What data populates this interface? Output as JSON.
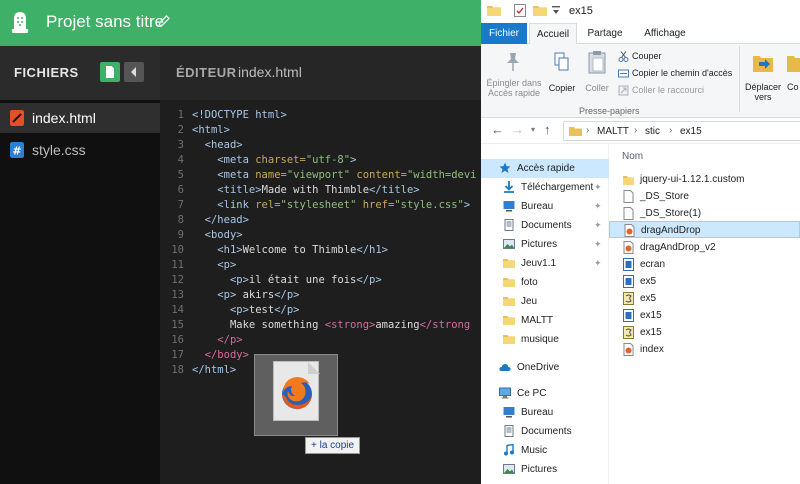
{
  "thimble": {
    "project_title": "Projet sans titre",
    "files_header": "FICHIERS",
    "editor_label": "ÉDITEUR",
    "editor_filename": "index.html",
    "files": [
      {
        "name": "index.html",
        "icon": "html-file-icon"
      },
      {
        "name": "style.css",
        "icon": "css-file-icon"
      }
    ],
    "line_numbers": [
      "1",
      "2",
      "3",
      "4",
      "5",
      "6",
      "7",
      "8",
      "9",
      "10",
      "11",
      "12",
      "13",
      "14",
      "15",
      "16",
      "17",
      "18"
    ],
    "code": {
      "l1": "<!DOCTYPE html>",
      "l2": "<html>",
      "l3": "<head>",
      "l4_tag": "<meta",
      "l4_attr": "charset=",
      "l4_val": "\"utf-8\"",
      "l4_end": ">",
      "l5_tag": "<meta",
      "l5_attr": "name=",
      "l5_val": "\"viewport\"",
      "l5_attr2": "content=",
      "l5_val2": "\"width=devi",
      "l6_tag": "<title>",
      "l6_text": "Made with Thimble",
      "l6_end": "</title>",
      "l7_tag": "<link",
      "l7_attr": "rel=",
      "l7_val": "\"stylesheet\"",
      "l7_attr2": "href=",
      "l7_val2": "\"style.css\"",
      "l7_end": ">",
      "l8": "</head>",
      "l9": "<body>",
      "l10_tag": "<h1>",
      "l10_text": "Welcome to Thimble",
      "l10_end": "</h1>",
      "l11": "<p>",
      "l12_tag": "<p>",
      "l12_text": "il était une fois",
      "l12_end": "</p>",
      "l13_tag": "<p>",
      "l13_text": " akirs",
      "l13_end": "</p>",
      "l14_tag": "<p>",
      "l14_text": "test",
      "l14_end": "</p>",
      "l15_text": "Make something ",
      "l15_tag": "<strong>",
      "l15_strong": "amazing",
      "l15_end": "</strong",
      "l16": "</p>",
      "l17": "</body>",
      "l18": "</html>"
    },
    "drag_tooltip": "+ la copie"
  },
  "explorer": {
    "window_title": "ex15",
    "tabs": [
      "Fichier",
      "Accueil",
      "Partage",
      "Affichage"
    ],
    "ribbon": {
      "pin_label_1": "Épingler dans",
      "pin_label_2": "Accès rapide",
      "copy_label": "Copier",
      "paste_label": "Coller",
      "cut_label": "Couper",
      "copy_path_label": "Copier le chemin d'accès",
      "paste_shortcut_label": "Coller le raccourci",
      "group_label": "Presse-papiers",
      "move_label_1": "Déplacer",
      "move_label_2": "vers",
      "copy_to_label": "Co"
    },
    "breadcrumbs": [
      "MALTT",
      "stic",
      "ex15"
    ],
    "nav_items": [
      {
        "label": "Accès rapide",
        "icon": "star-icon",
        "pinned": false
      },
      {
        "label": "Téléchargement",
        "icon": "download-icon",
        "pinned": true
      },
      {
        "label": "Bureau",
        "icon": "desktop-icon",
        "pinned": true
      },
      {
        "label": "Documents",
        "icon": "documents-icon",
        "pinned": true
      },
      {
        "label": "Pictures",
        "icon": "pictures-icon",
        "pinned": true
      },
      {
        "label": "Jeuv1.1",
        "icon": "folder-icon",
        "pinned": true
      },
      {
        "label": "foto",
        "icon": "folder-icon",
        "pinned": false
      },
      {
        "label": "Jeu",
        "icon": "folder-icon",
        "pinned": false
      },
      {
        "label": "MALTT",
        "icon": "folder-icon",
        "pinned": false
      },
      {
        "label": "musique",
        "icon": "folder-icon",
        "pinned": false
      },
      {
        "label": "OneDrive",
        "icon": "cloud-icon",
        "pinned": false
      },
      {
        "label": "Ce PC",
        "icon": "computer-icon",
        "pinned": false
      },
      {
        "label": "Bureau",
        "icon": "desktop-icon",
        "pinned": false
      },
      {
        "label": "Documents",
        "icon": "documents-icon",
        "pinned": false
      },
      {
        "label": "Music",
        "icon": "music-icon",
        "pinned": false
      },
      {
        "label": "Pictures",
        "icon": "pictures-icon",
        "pinned": false
      }
    ],
    "column_name": "Nom",
    "files": [
      {
        "name": "jquery-ui-1.12.1.custom",
        "icon": "folder-icon",
        "selected": false
      },
      {
        "name": "_DS_Store",
        "icon": "blank-file-icon",
        "selected": false
      },
      {
        "name": "_DS_Store(1)",
        "icon": "blank-file-icon",
        "selected": false
      },
      {
        "name": "dragAndDrop",
        "icon": "html-file-icon",
        "selected": true
      },
      {
        "name": "dragAndDrop_v2",
        "icon": "html-file-icon",
        "selected": false
      },
      {
        "name": "ecran",
        "icon": "css-file-icon",
        "selected": false
      },
      {
        "name": "ex5",
        "icon": "css-file-icon",
        "selected": false
      },
      {
        "name": "ex5",
        "icon": "js-file-icon",
        "selected": false
      },
      {
        "name": "ex15",
        "icon": "css-file-icon",
        "selected": false
      },
      {
        "name": "ex15",
        "icon": "js-file-icon",
        "selected": false
      },
      {
        "name": "index",
        "icon": "html-file-icon",
        "selected": false
      }
    ]
  },
  "colors": {
    "thimble_green": "#3fb068",
    "explorer_blue": "#1979ca",
    "selection": "#cce8ff"
  }
}
